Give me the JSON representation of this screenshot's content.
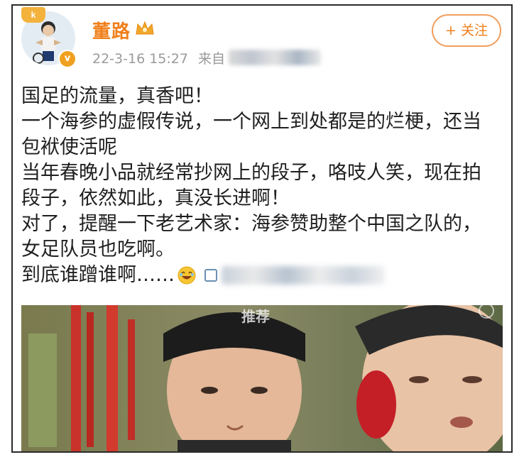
{
  "post": {
    "author": {
      "name": "董路",
      "avatar_badge": "k",
      "verified_badge": "v",
      "crown_icon": "crown-icon"
    },
    "timestamp": "22-3-16 15:27",
    "source_prefix": "来自",
    "follow_label": "+ 关注",
    "text_lines": [
      "国足的流量，真香吧！",
      "一个海参的虚假传说，一个网上到处都是的烂梗，还当",
      "包袱使活呢",
      "当年春晚小品就经常抄网上的段子，咯吱人笑，现在拍",
      "段子，依然如此，真没长进啊！",
      "对了，提醒一下老艺术家：海参赞助整个中国之队的，",
      "女足队员也吃啊。",
      "到底谁蹭谁啊……"
    ],
    "emoji": "laugh-icon",
    "video_caption": "推荐",
    "colors": {
      "username": "#f07f1a",
      "follow_border": "#f0a060",
      "meta": "#9a9a9a",
      "text": "#1f1f1f"
    }
  }
}
